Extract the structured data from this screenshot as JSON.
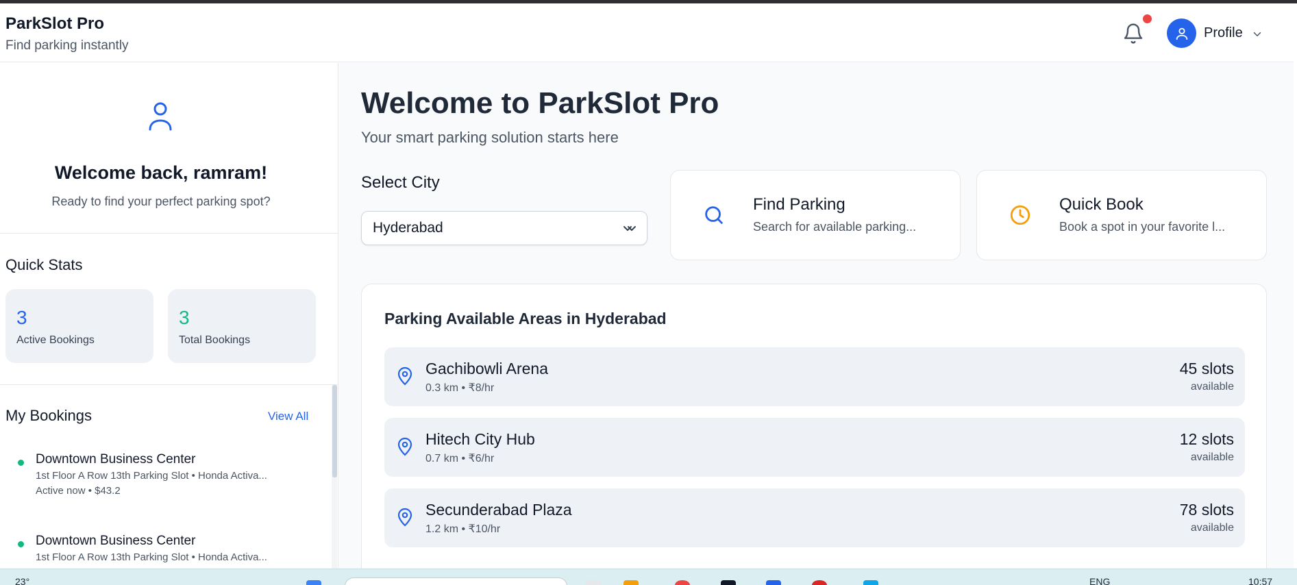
{
  "header": {
    "brand_title": "ParkSlot Pro",
    "brand_subtitle": "Find parking instantly",
    "profile_label": "Profile",
    "icons": [
      "bell-icon",
      "user-icon",
      "chevron-down-icon"
    ]
  },
  "sidebar": {
    "welcome": "Welcome back, ramram!",
    "prompt": "Ready to find your perfect parking spot?",
    "quick_stats_title": "Quick Stats",
    "stats": [
      {
        "value": "3",
        "label": "Active Bookings",
        "color": "#2563eb"
      },
      {
        "value": "3",
        "label": "Total Bookings",
        "color": "#10b981"
      }
    ],
    "my_bookings_title": "My Bookings",
    "view_all": "View All",
    "bookings": [
      {
        "name": "Downtown Business Center",
        "detail": "1st Floor A Row 13th Parking Slot • Honda Activa...",
        "status": "Active now • $43.2"
      },
      {
        "name": "Downtown Business Center",
        "detail": "1st Floor A Row 13th Parking Slot • Honda Activa...",
        "status": ""
      }
    ]
  },
  "main": {
    "title": "Welcome to ParkSlot Pro",
    "subtitle": "Your smart parking solution starts here",
    "select_city_label": "Select City",
    "city_value": "Hyderabad",
    "actions": [
      {
        "title": "Find Parking",
        "subtitle": "Search for available parking...",
        "icon": "search-icon",
        "color": "#2563eb"
      },
      {
        "title": "Quick Book",
        "subtitle": "Book a spot in your favorite l...",
        "icon": "clock-icon",
        "color": "#f59e0b"
      }
    ],
    "areas_title": "Parking Available Areas in Hyderabad",
    "areas": [
      {
        "name": "Gachibowli Arena",
        "meta": "0.3 km • ₹8/hr",
        "slots": "45 slots",
        "available": "available"
      },
      {
        "name": "Hitech City Hub",
        "meta": "0.7 km • ₹6/hr",
        "slots": "12 slots",
        "available": "available"
      },
      {
        "name": "Secunderabad Plaza",
        "meta": "1.2 km • ₹10/hr",
        "slots": "78 slots",
        "available": "available"
      }
    ]
  },
  "taskbar": {
    "temperature": "23°",
    "language": "ENG",
    "time": "10:57"
  },
  "colors": {
    "primary": "#2563eb",
    "success": "#10b981",
    "warning": "#f59e0b",
    "danger": "#ef4444"
  }
}
